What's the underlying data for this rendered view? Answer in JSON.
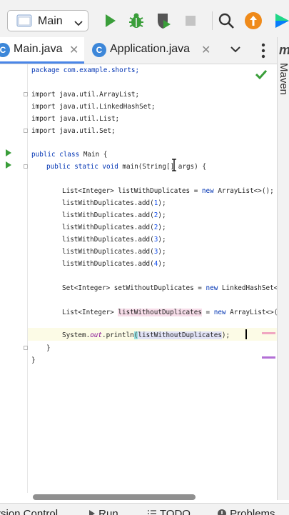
{
  "toolbar": {
    "run_config": "Main",
    "buttons": [
      "run-icon",
      "debug-icon",
      "coverage-icon",
      "stop-icon",
      "search-icon",
      "update-icon",
      "plugin-icon"
    ]
  },
  "tabs": [
    {
      "label": "Main.java",
      "icon_letter": "C",
      "active": true
    },
    {
      "label": "Application.java",
      "icon_letter": "C",
      "active": false
    }
  ],
  "side_panel": {
    "label": "Maven",
    "icon_letter": "m"
  },
  "code": {
    "line1": "package com.example.shorts;",
    "imp1": "import java.util.ArrayList;",
    "imp2": "import java.util.LinkedHashSet;",
    "imp3": "import java.util.List;",
    "imp4": "import java.util.Set;",
    "cls_kw1": "public",
    "cls_kw2": "class",
    "cls_name": "Main {",
    "m_kw1": "public",
    "m_kw2": "static",
    "m_kw3": "void",
    "m_rest": "main(String[] args) {",
    "decl_type": "List<Integer> listWithDuplicates = ",
    "decl_new": "new",
    "decl_rest": "ArrayList<>();",
    "add_prefix": "listWithDuplicates.add(",
    "add_values": [
      "1",
      "2",
      "2",
      "3",
      "3",
      "4"
    ],
    "add_suffix": ");",
    "set_type": "Set<Integer> setWithoutDuplicates = ",
    "set_new": "new",
    "set_rest": "LinkedHashSet<>(",
    "list2_type": "List<Integer> ",
    "list2_var": "listWithoutDuplicates",
    "list2_eq": " = ",
    "list2_new": "new",
    "list2_rest": "ArrayList<>(se",
    "print_sys": "System.",
    "print_out": "out",
    "print_rest": ".println",
    "print_open": "(",
    "print_arg": "listWithoutDuplicates",
    "print_close": ");",
    "close_method": "}",
    "close_class": "}"
  },
  "bottom_bar": [
    "rsion Control",
    "Run",
    "TODO",
    "Problems"
  ],
  "colors": {
    "keyword": "#0033b3",
    "number": "#1750eb",
    "field": "#871094",
    "run_green": "#3a9e3a",
    "accent": "#4a86e8"
  }
}
